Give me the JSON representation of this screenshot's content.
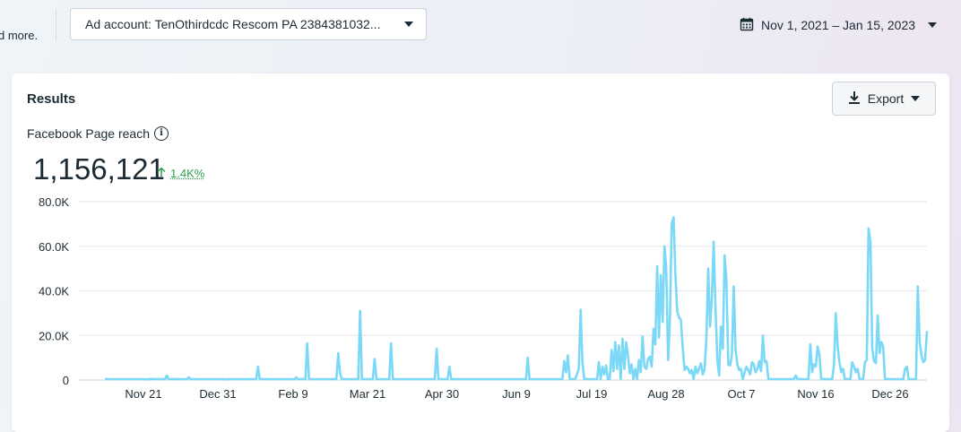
{
  "header": {
    "left_fragment": "d more.",
    "ad_account_label": "Ad account: TenOthirdcdc Rescom PA 2384381032...",
    "date_range": "Nov 1, 2021 – Jan 15, 2023"
  },
  "card": {
    "title": "Results",
    "export_label": "Export",
    "metric_label": "Facebook Page reach",
    "metric_value": "1,156,121",
    "metric_change": "1.4K%"
  },
  "colors": {
    "line": "#7bd8f6",
    "positive": "#31a24c",
    "text": "#1c2b33",
    "grid": "#e4e6eb"
  },
  "chart_data": {
    "type": "line",
    "title": "",
    "xlabel": "",
    "ylabel": "",
    "ylim": [
      0,
      80000
    ],
    "yticks": [
      0,
      20000,
      40000,
      60000,
      80000
    ],
    "ytick_labels": [
      "0",
      "20.0K",
      "40.0K",
      "60.0K",
      "80.0K"
    ],
    "xtick_labels": [
      "Nov 21",
      "Dec 31",
      "Feb 9",
      "Mar 21",
      "Apr 30",
      "Jun 9",
      "Jul 19",
      "Aug 28",
      "Oct 7",
      "Nov 16",
      "Dec 26"
    ],
    "grid": true,
    "series": [
      {
        "values": [
          0,
          0,
          0,
          0,
          0,
          0,
          0,
          0,
          0,
          0,
          0,
          0,
          0,
          0,
          0,
          0,
          0,
          0,
          0,
          0,
          0,
          0,
          300,
          0,
          200,
          600,
          0,
          0,
          0,
          0,
          0,
          0,
          0,
          0,
          2000,
          0,
          0,
          0,
          500,
          0,
          0,
          0,
          0,
          0,
          0,
          0,
          1200,
          0,
          0,
          0,
          0,
          0,
          0,
          0,
          0,
          0,
          0,
          0,
          0,
          0,
          0,
          0,
          0,
          0,
          0,
          0,
          200,
          0,
          0,
          0,
          0,
          0,
          0,
          0,
          0,
          0,
          0,
          0,
          0,
          0,
          0,
          0,
          0,
          0,
          6000,
          0,
          0,
          0,
          0,
          0,
          0,
          0,
          0,
          0,
          0,
          0,
          0,
          0,
          0,
          0,
          0,
          0,
          0,
          0,
          0,
          1200,
          0,
          0,
          0,
          500,
          0,
          16500,
          0,
          0,
          0,
          0,
          0,
          0,
          0,
          0,
          0,
          0,
          0,
          0,
          0,
          0,
          0,
          0,
          12000,
          3000,
          0,
          0,
          0,
          0,
          0,
          0,
          0,
          0,
          0,
          0,
          31000,
          0,
          0,
          0,
          0,
          0,
          0,
          0,
          9500,
          0,
          0,
          0,
          0,
          0,
          0,
          0,
          0,
          16500,
          0,
          0,
          0,
          0,
          0,
          0,
          0,
          0,
          0,
          0,
          0,
          0,
          0,
          0,
          0,
          0,
          0,
          0,
          0,
          0,
          0,
          0,
          0,
          0,
          14000,
          0,
          0,
          0,
          0,
          0,
          0,
          6000,
          0,
          0,
          0,
          0,
          0,
          0,
          0,
          0,
          0,
          0,
          0,
          0,
          0,
          0,
          0,
          0,
          0,
          0,
          0,
          0,
          0,
          0,
          0,
          0,
          0,
          0,
          0,
          0,
          0,
          0,
          0,
          0,
          0,
          0,
          0,
          0,
          0,
          0,
          0,
          0,
          0,
          0,
          10000,
          0,
          0,
          0,
          0,
          0,
          0,
          0,
          0,
          0,
          0,
          0,
          0,
          0,
          0,
          0,
          0,
          0,
          0,
          0,
          8500,
          3500,
          11000,
          0,
          0,
          0,
          0,
          2500,
          5000,
          31500,
          8000,
          0,
          0,
          0,
          0,
          0,
          0,
          0,
          0,
          8000,
          0,
          6000,
          2500,
          6500,
          0,
          0,
          13500,
          4000,
          17000,
          5000,
          15500,
          0,
          18500,
          5000,
          17000,
          11000,
          3000,
          7000,
          0,
          5000,
          0,
          9000,
          3500,
          19500,
          6000,
          5000,
          9500,
          10500,
          6000,
          23000,
          16000,
          51000,
          19000,
          47000,
          26000,
          60000,
          50000,
          9000,
          27000,
          70000,
          73000,
          47500,
          31000,
          28000,
          27000,
          15000,
          4500,
          6000,
          5000,
          3000,
          4500,
          0,
          6000,
          3000,
          5000,
          7500,
          2500,
          4500,
          19000,
          50000,
          24000,
          36500,
          62000,
          33000,
          9000,
          2000,
          24000,
          14000,
          56000,
          45000,
          7000,
          6500,
          11000,
          42000,
          14000,
          7000,
          4500,
          5000,
          0,
          3500,
          6000,
          4500,
          2500,
          8000,
          7000,
          3500,
          5000,
          8500,
          4000,
          20000,
          8000,
          8500,
          0,
          0,
          0,
          0,
          0,
          0,
          0,
          0,
          0,
          0,
          0,
          0,
          0,
          0,
          0,
          2000,
          0,
          0,
          0,
          0,
          0,
          0,
          0,
          16000,
          3500,
          7000,
          6000,
          15000,
          11500,
          0,
          0,
          0,
          0,
          0,
          0,
          0,
          6500,
          30000,
          15000,
          8000,
          3500,
          5000,
          0,
          0,
          0,
          0,
          8000,
          6000,
          3500,
          5000,
          0,
          0,
          0,
          8000,
          9000,
          68000,
          62000,
          14000,
          8500,
          7500,
          29000,
          12000,
          17000,
          15000,
          0,
          0,
          0,
          0,
          0,
          0,
          0,
          0,
          0,
          0,
          0,
          5000,
          6000,
          0,
          0,
          0,
          0,
          0,
          42000,
          17000,
          11000,
          8000,
          9000,
          22000
        ]
      }
    ]
  }
}
